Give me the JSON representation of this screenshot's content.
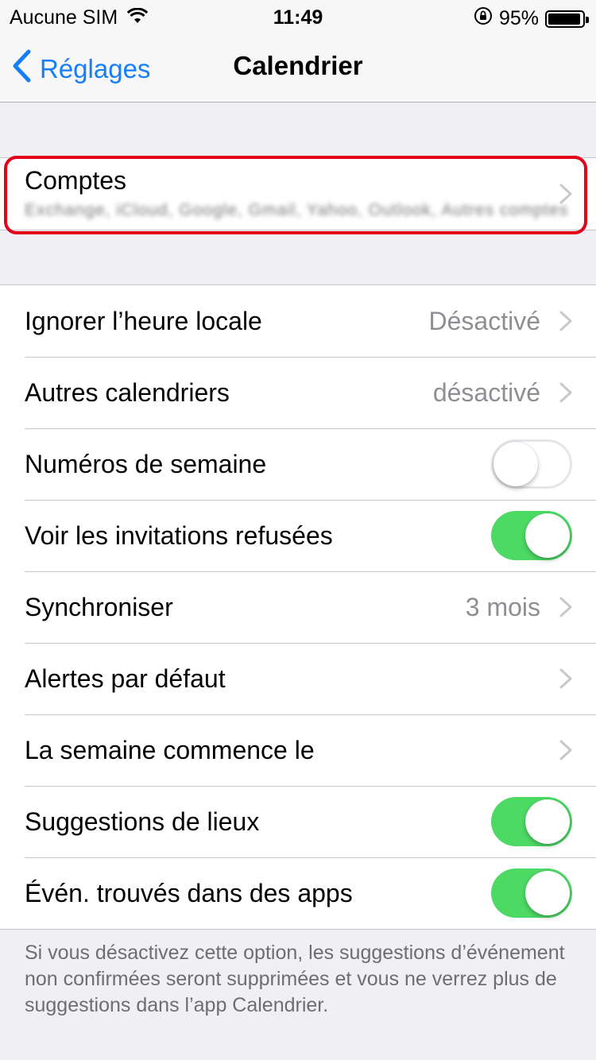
{
  "status_bar": {
    "carrier": "Aucune SIM",
    "time": "11:49",
    "battery_percent": "95%",
    "battery_level": 0.95,
    "icons": [
      "wifi-icon",
      "orientation-lock-icon",
      "battery-icon"
    ]
  },
  "nav": {
    "back_label": "Réglages",
    "title": "Calendrier"
  },
  "accounts": {
    "label": "Comptes",
    "subtitle": "Exchange, iCloud, Google, Gmail, Yahoo, Outlook, Autres comptes"
  },
  "settings": {
    "items": [
      {
        "label": "Ignorer l’heure locale",
        "value": "Désactivé",
        "kind": "disclosure"
      },
      {
        "label": "Autres calendriers",
        "value": "désactivé",
        "kind": "disclosure"
      },
      {
        "label": "Numéros de semaine",
        "kind": "toggle",
        "on": false
      },
      {
        "label": "Voir les invitations refusées",
        "kind": "toggle",
        "on": true
      },
      {
        "label": "Synchroniser",
        "value": "3 mois",
        "kind": "disclosure"
      },
      {
        "label": "Alertes par défaut",
        "value": "",
        "kind": "disclosure"
      },
      {
        "label": "La semaine commence le",
        "value": "",
        "kind": "disclosure"
      },
      {
        "label": "Suggestions de lieux",
        "kind": "toggle",
        "on": true
      },
      {
        "label": "Évén. trouvés dans des apps",
        "kind": "toggle",
        "on": true
      }
    ]
  },
  "footer_note": "Si vous désactivez cette option, les suggestions d’événement non confirmées seront supprimées et vous ne verrez plus de suggestions dans l’app Calendrier.",
  "colors": {
    "accent": "#157efb",
    "toggle_on": "#4cd964",
    "highlight": "#e4001b",
    "background": "#efeff4"
  }
}
